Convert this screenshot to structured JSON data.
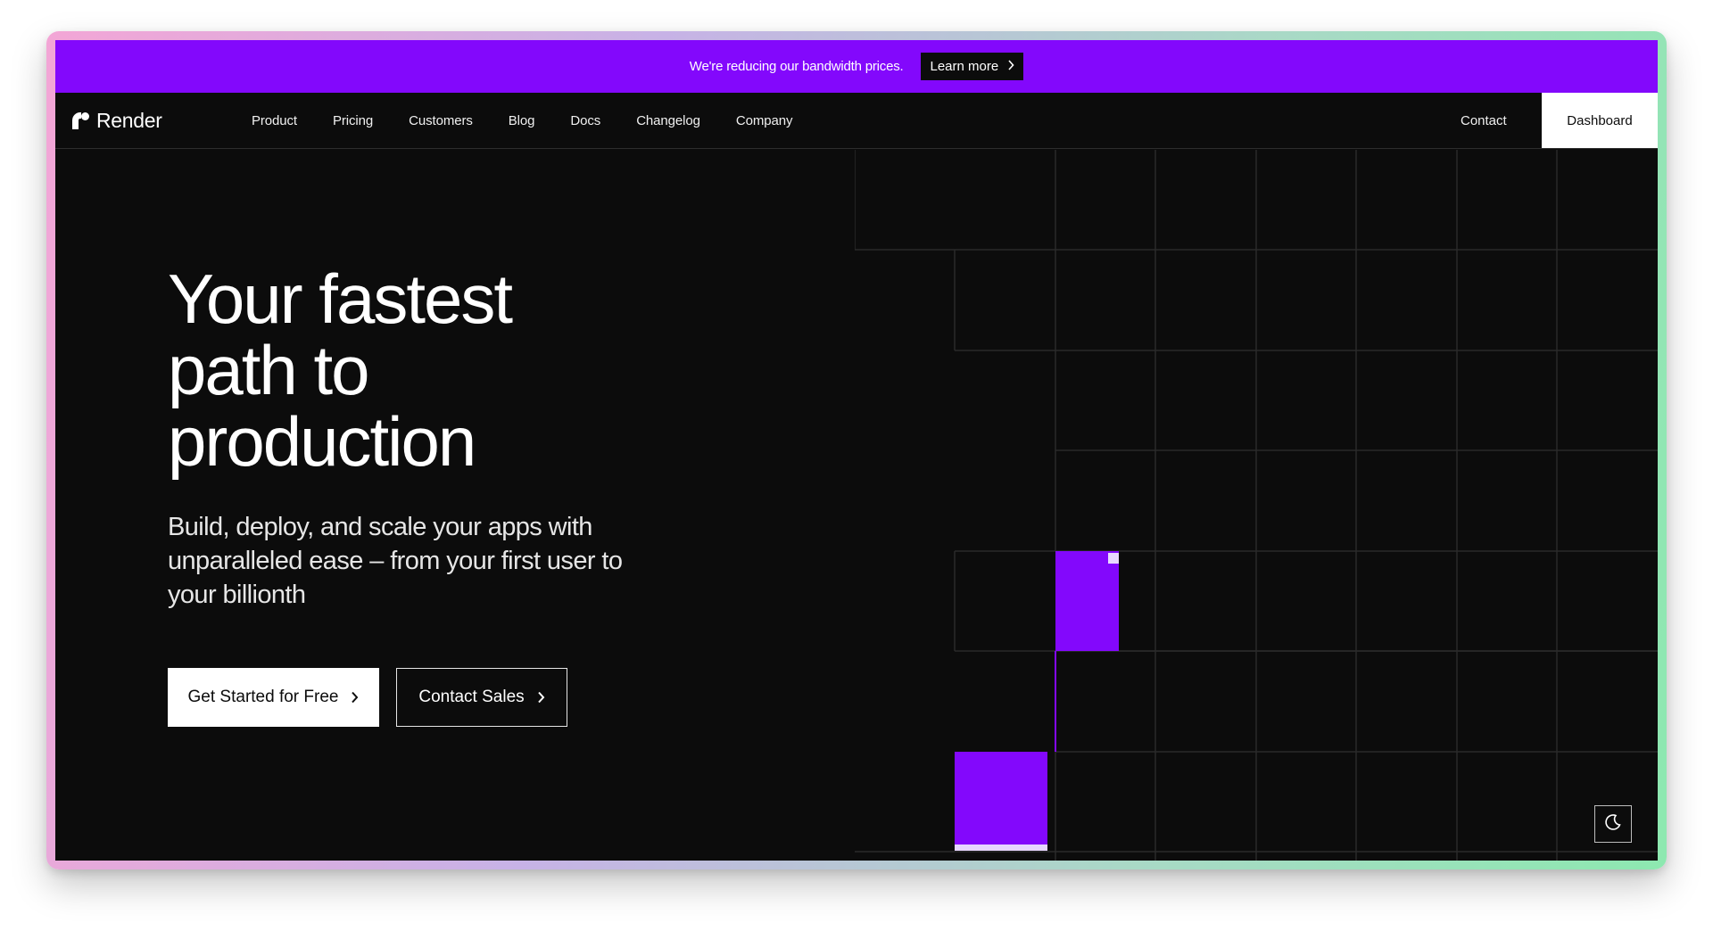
{
  "banner": {
    "text": "We're reducing our bandwidth prices.",
    "cta_label": "Learn more"
  },
  "nav": {
    "logo_text": "Render",
    "links": [
      "Product",
      "Pricing",
      "Customers",
      "Blog",
      "Docs",
      "Changelog",
      "Company"
    ],
    "contact_label": "Contact",
    "dashboard_label": "Dashboard"
  },
  "hero": {
    "title": "Your fastest\npath to\nproduction",
    "subtitle": "Build, deploy, and scale your apps with unparalleled ease – from your first user to your billionth",
    "primary_cta": "Get Started for Free",
    "secondary_cta": "Contact Sales"
  },
  "colors": {
    "accent": "#8308fc",
    "background": "#0c0c0c",
    "text": "#ffffff"
  },
  "icons": {
    "logo": "render-logo-icon",
    "chevron": "chevron-right-icon",
    "theme": "moon-icon"
  }
}
